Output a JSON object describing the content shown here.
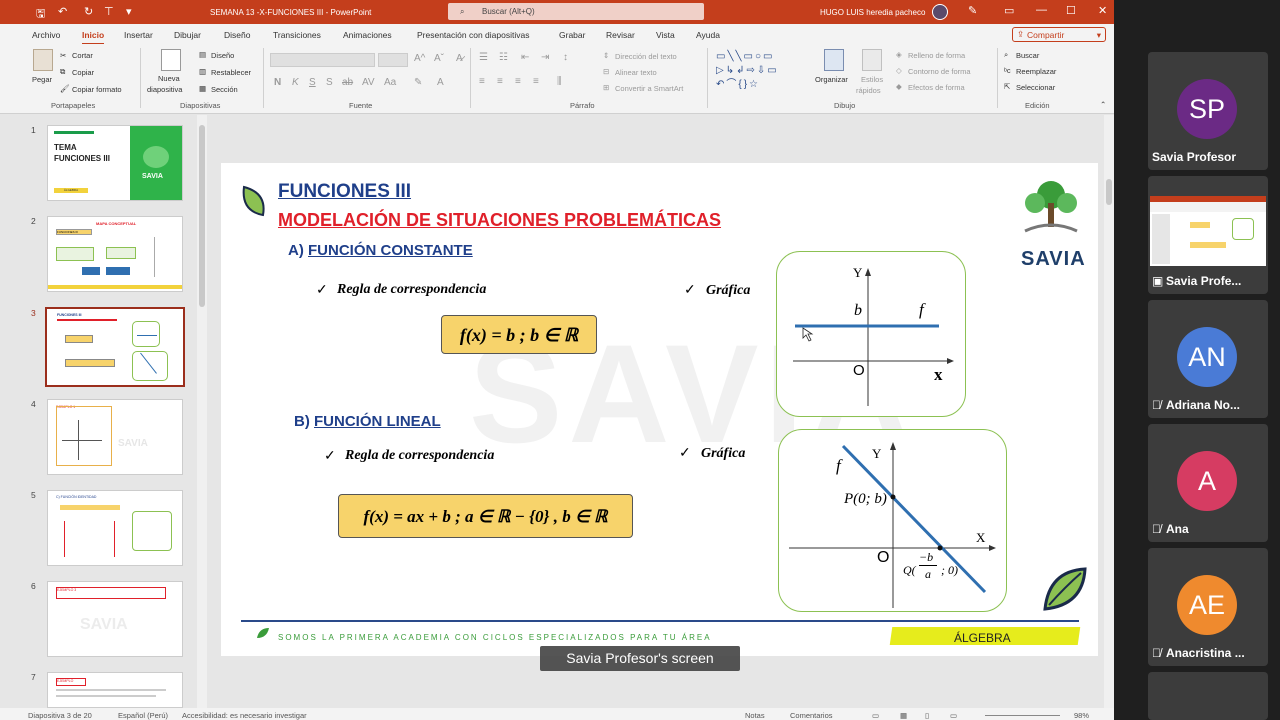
{
  "titlebar": {
    "window_title": "SEMANA 13 -X-FUNCIONES III  -  PowerPoint",
    "search_placeholder": "Buscar (Alt+Q)",
    "user_name": "HUGO LUIS heredia pacheco"
  },
  "tabs": [
    "Archivo",
    "Inicio",
    "Insertar",
    "Dibujar",
    "Diseño",
    "Transiciones",
    "Animaciones",
    "Presentación con diapositivas",
    "Grabar",
    "Revisar",
    "Vista",
    "Ayuda"
  ],
  "active_tab": "Inicio",
  "share_label": "Compartir",
  "ribbon": {
    "clipboard": {
      "paste": "Pegar",
      "cut": "Cortar",
      "copy": "Copiar",
      "format_painter": "Copiar formato",
      "group": "Portapapeles"
    },
    "slides": {
      "new_slide_1": "Nueva",
      "new_slide_2": "diapositiva",
      "layout": "Diseño",
      "reset": "Restablecer",
      "section": "Sección",
      "group": "Diapositivas"
    },
    "font": {
      "bold": "N",
      "italic": "K",
      "underline": "S",
      "strike": "S",
      "group": "Fuente"
    },
    "paragraph": {
      "text_direction": "Dirección del texto",
      "align_text": "Alinear texto",
      "smartart": "Convertir a SmartArt",
      "group": "Párrafo"
    },
    "drawing": {
      "arrange_1": "Organizar",
      "quick_styles_1": "Estilos",
      "quick_styles_2": "rápidos",
      "shape_fill": "Relleno de forma",
      "shape_outline": "Contorno de forma",
      "shape_effects": "Efectos de forma",
      "group": "Dibujo"
    },
    "editing": {
      "find": "Buscar",
      "replace": "Reemplazar",
      "select": "Seleccionar",
      "group": "Edición"
    }
  },
  "thumbnails": [
    {
      "num": "1",
      "title": "TEMA\nFUNCIONES III",
      "label": "ÁLGEBRA",
      "logo": "SAVIA"
    },
    {
      "num": "2",
      "title": "MAPA CONCEPTUAL",
      "label": "FUNCIONES III"
    },
    {
      "num": "3",
      "title": "FUNCIONES III"
    },
    {
      "num": "4",
      "title": "EJEMPLO 1"
    },
    {
      "num": "5",
      "title": "C) FUNCIÓN IDENTIDAD"
    },
    {
      "num": "6",
      "title": "EJEMPLO 3"
    },
    {
      "num": "7",
      "title": "EJEMPLO"
    }
  ],
  "slide": {
    "title": "FUNCIONES III",
    "subtitle": "MODELACIÓN DE SITUACIONES PROBLEMÁTICAS",
    "section_a_letter": "A)",
    "section_a": "FUNCIÓN CONSTANTE",
    "rule_label_a": "Regla de correspondencia",
    "graph_label_a": "Gráfica",
    "formula_a": "f(x) = b ;  b ∈ ℝ",
    "graph_a": {
      "y_label": "Y",
      "x_label": "x",
      "origin": "O",
      "b_label": "b",
      "f_label": "f"
    },
    "section_b_letter": "B)",
    "section_b": "FUNCIÓN LINEAL",
    "rule_label_b": "Regla de correspondencia",
    "graph_label_b": "Gráfica",
    "formula_b": "f(x) = ax +  b ;  a ∈ ℝ − {0} , b ∈ ℝ",
    "graph_b": {
      "y_label": "Y",
      "x_label": "X",
      "origin": "O",
      "f_label": "f",
      "p_label": "P(0; b)",
      "q_prefix": "Q(",
      "q_num": "−b",
      "q_den": "a",
      "q_suffix": "; 0)"
    },
    "logo_text": "SAVIA",
    "watermark": "SAVIA",
    "footer_text": "SOMOS LA PRIMERA ACADEMIA CON CICLOS ESPECIALIZADOS PARA TU ÁREA",
    "subject": "ÁLGEBRA"
  },
  "statusbar": {
    "slide_info": "Diapositiva 3 de 20",
    "language": "Español (Perú)",
    "accessibility": "Accesibilidad: es necesario investigar",
    "notes": "Notas",
    "comments": "Comentarios",
    "zoom": "98%"
  },
  "caption": "Savia Profesor's screen",
  "participants": [
    {
      "initials": "SP",
      "name": "Savia Profesor",
      "color": "#6b2a85",
      "muted": false
    },
    {
      "initials": "",
      "name": "Savia Profe...",
      "color": "#ffffff",
      "muted": false,
      "screen": true
    },
    {
      "initials": "AN",
      "name": "Adriana No...",
      "color": "#4a7bd6",
      "muted": true
    },
    {
      "initials": "A",
      "name": "Ana",
      "color": "#d63c62",
      "muted": true
    },
    {
      "initials": "AE",
      "name": "Anacristina ...",
      "color": "#ef8a2e",
      "muted": true
    }
  ],
  "colors": {
    "accent": "#c43e1c",
    "title_blue": "#1f3f8a",
    "subtitle_red": "#e0202a",
    "formula_fill": "#f7d36b",
    "graph_border": "#8cc152",
    "line_blue": "#2f6fb0"
  }
}
